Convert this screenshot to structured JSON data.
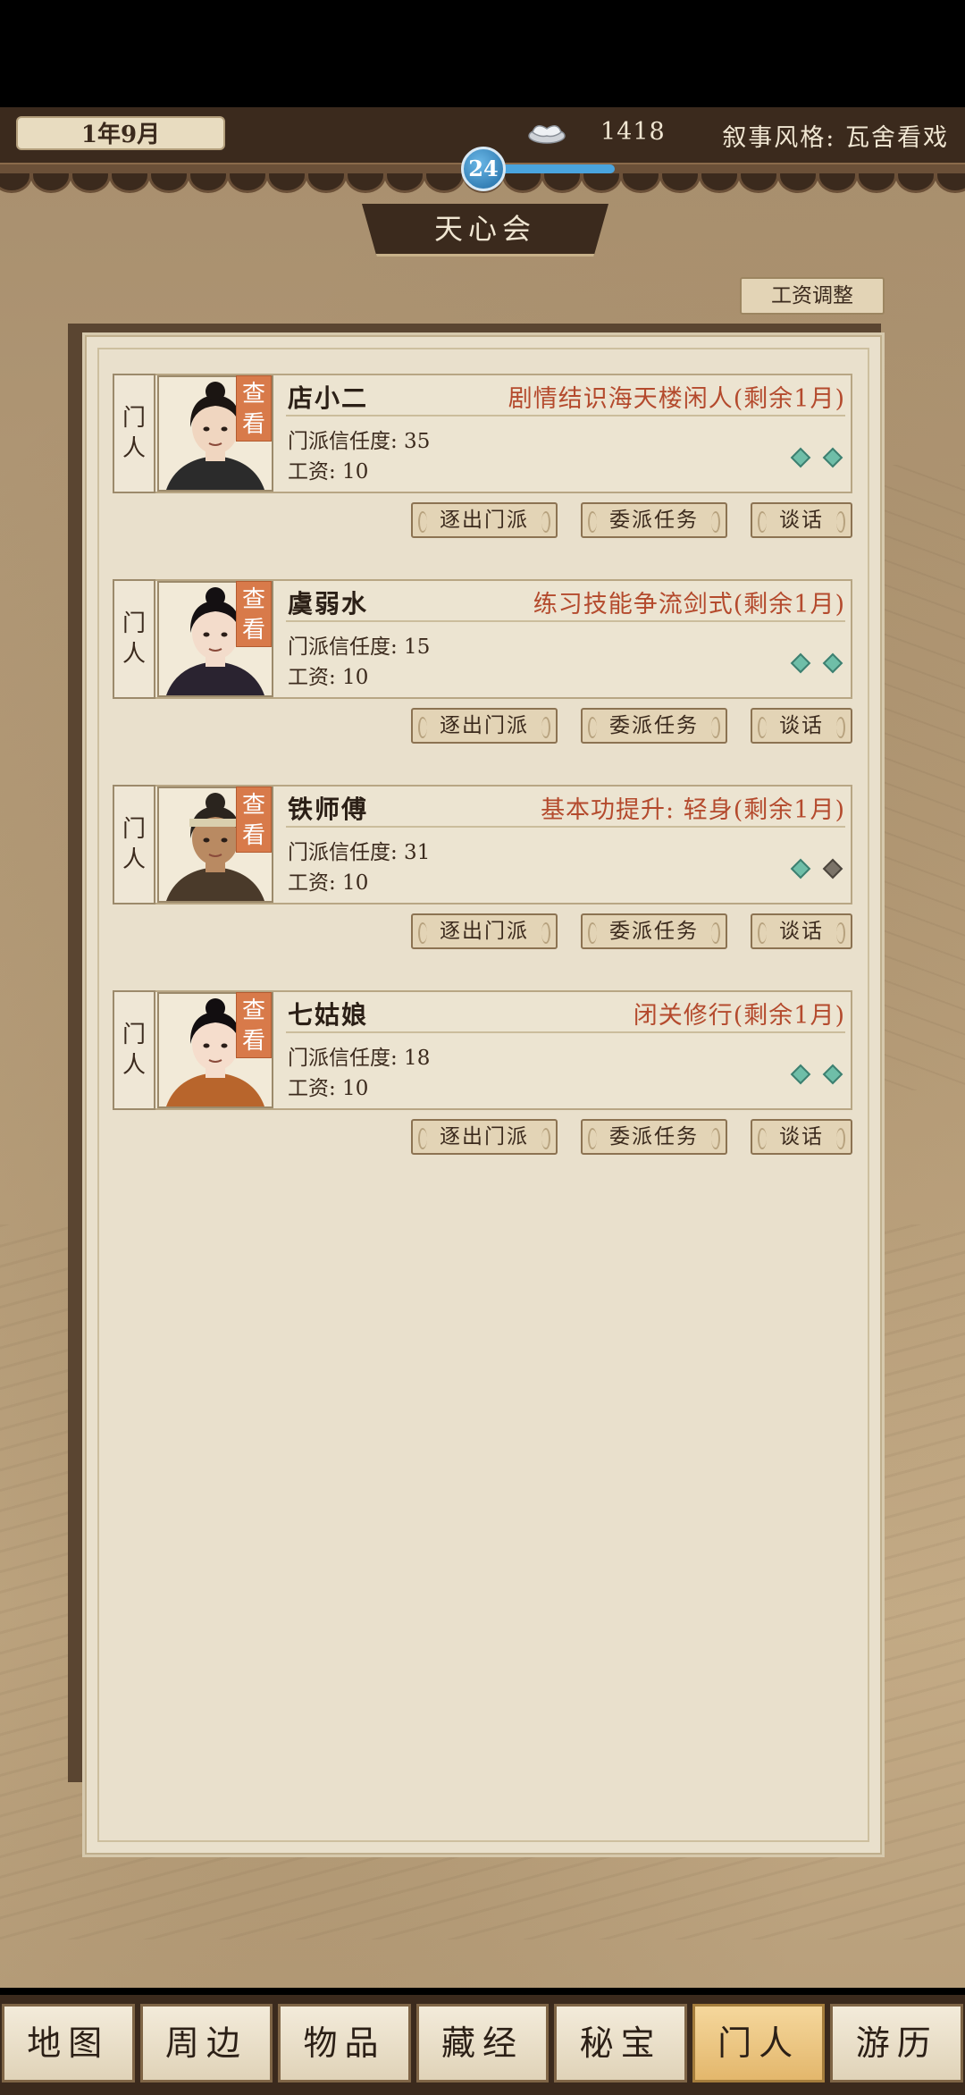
{
  "header": {
    "date": "1年9月",
    "silver": "1418",
    "narrative_style": "叙事风格: 瓦舍看戏",
    "level": "24",
    "level_progress": 0.4
  },
  "title": "天心会",
  "wage_button": "工资调整",
  "members": [
    {
      "rank": [
        "门",
        "人"
      ],
      "view": [
        "查",
        "看"
      ],
      "name": "店小二",
      "status": "剧情结识海天楼闲人(剩余1月)",
      "trust": "门派信任度: 35",
      "wage": "工资: 10",
      "gems": [
        true,
        true
      ]
    },
    {
      "rank": [
        "门",
        "人"
      ],
      "view": [
        "查",
        "看"
      ],
      "name": "虞弱水",
      "status": "练习技能争流剑式(剩余1月)",
      "trust": "门派信任度: 15",
      "wage": "工资: 10",
      "gems": [
        true,
        true
      ]
    },
    {
      "rank": [
        "门",
        "人"
      ],
      "view": [
        "查",
        "看"
      ],
      "name": "铁师傅",
      "status": "基本功提升: 轻身(剩余1月)",
      "trust": "门派信任度: 31",
      "wage": "工资: 10",
      "gems": [
        true,
        false
      ]
    },
    {
      "rank": [
        "门",
        "人"
      ],
      "view": [
        "查",
        "看"
      ],
      "name": "七姑娘",
      "status": "闭关修行(剩余1月)",
      "trust": "门派信任度: 18",
      "wage": "工资: 10",
      "gems": [
        true,
        true
      ]
    }
  ],
  "actions": {
    "expel": "逐出门派",
    "assign": "委派任务",
    "talk": "谈话"
  },
  "nav": [
    "地图",
    "周边",
    "物品",
    "藏经",
    "秘宝",
    "门人",
    "游历"
  ],
  "nav_active": 5
}
